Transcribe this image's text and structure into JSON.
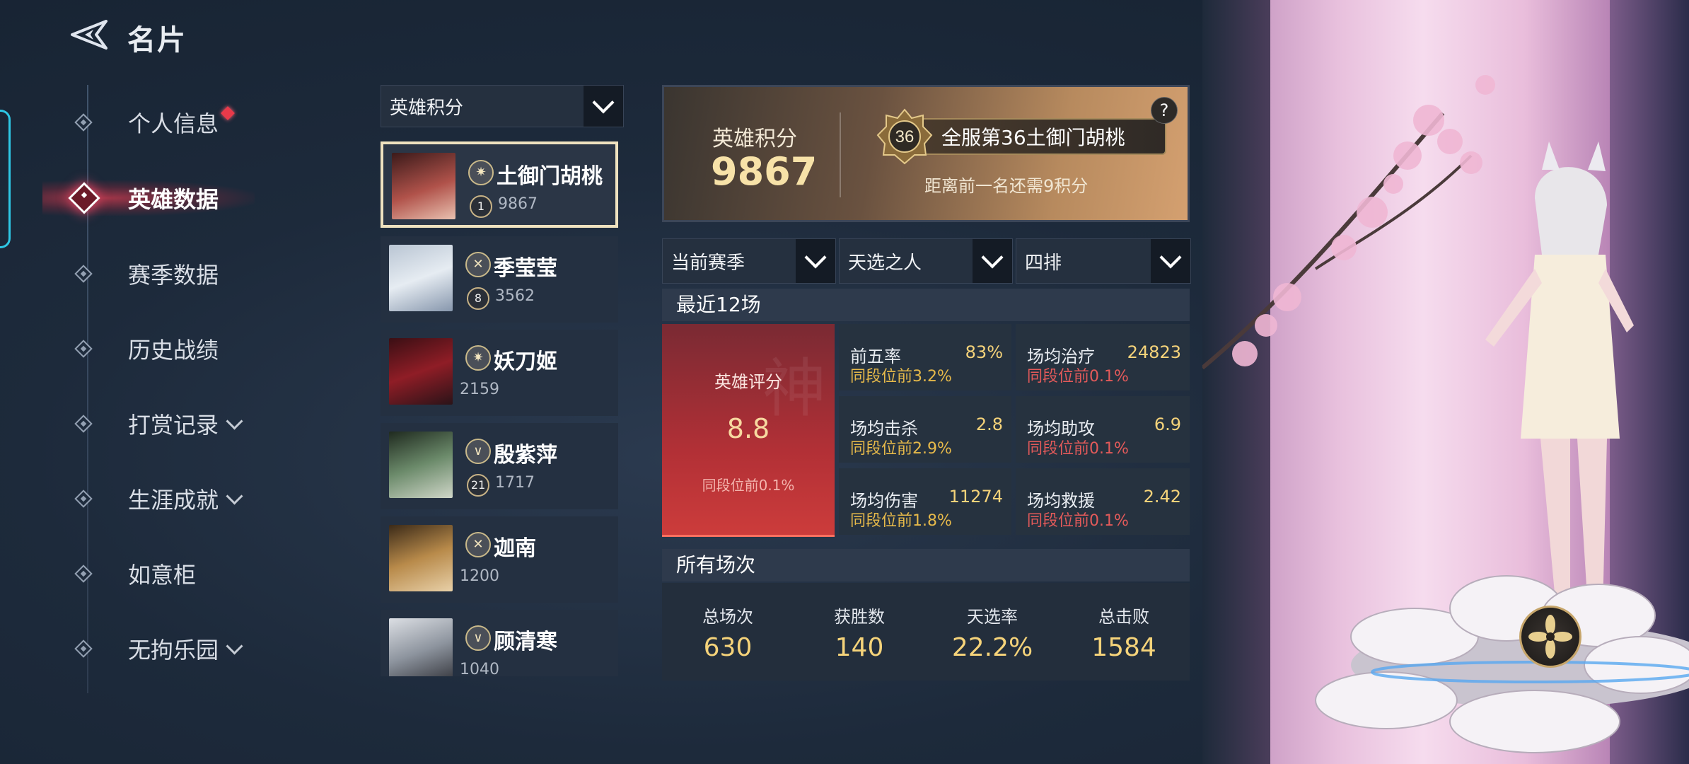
{
  "header": {
    "title": "名片"
  },
  "sidebar": {
    "items": [
      {
        "label": "个人信息"
      },
      {
        "label": "英雄数据"
      },
      {
        "label": "赛季数据"
      },
      {
        "label": "历史战绩"
      },
      {
        "label": "打赏记录"
      },
      {
        "label": "生涯成就"
      },
      {
        "label": "如意柜"
      },
      {
        "label": "无拘乐园"
      }
    ]
  },
  "hero_list": {
    "dropdown": "英雄积分",
    "heroes": [
      {
        "name": "土御门胡桃",
        "level": "1",
        "score": "9867"
      },
      {
        "name": "季莹莹",
        "level": "8",
        "score": "3562"
      },
      {
        "name": "妖刀姬",
        "score": "2159"
      },
      {
        "name": "殷紫萍",
        "level": "21",
        "score": "1717"
      },
      {
        "name": "迦南",
        "score": "1200"
      },
      {
        "name": "顾清寒",
        "score": "1040"
      }
    ]
  },
  "summary": {
    "label": "英雄积分",
    "value": "9867",
    "rank_number": "36",
    "rank_text": "全服第36土御门胡桃",
    "rank_sub": "距离前一名还需9积分",
    "help": "?"
  },
  "filters": {
    "season": "当前赛季",
    "mode": "天选之人",
    "queue": "四排"
  },
  "recent": {
    "title": "最近12场",
    "rating_label": "英雄评分",
    "rating_value": "8.8",
    "rating_sub": "同段位前0.1%",
    "watermark_char": "神",
    "stats": [
      {
        "label": "前五率",
        "value": "83%",
        "sub": "同段位前3.2%"
      },
      {
        "label": "场均治疗",
        "value": "24823",
        "sub": "同段位前0.1%"
      },
      {
        "label": "场均击杀",
        "value": "2.8",
        "sub": "同段位前2.9%"
      },
      {
        "label": "场均助攻",
        "value": "6.9",
        "sub": "同段位前0.1%"
      },
      {
        "label": "场均伤害",
        "value": "11274",
        "sub": "同段位前1.8%"
      },
      {
        "label": "场均救援",
        "value": "2.42",
        "sub": "同段位前0.1%"
      }
    ]
  },
  "all": {
    "title": "所有场次",
    "cols": [
      {
        "label": "总场次",
        "value": "630"
      },
      {
        "label": "获胜数",
        "value": "140"
      },
      {
        "label": "天选率",
        "value": "22.2%"
      },
      {
        "label": "总击败",
        "value": "1584"
      }
    ]
  },
  "colors": {
    "gold": "#f5d37a",
    "red": "#e35a5a",
    "accent_red": "#cc3c3b"
  }
}
